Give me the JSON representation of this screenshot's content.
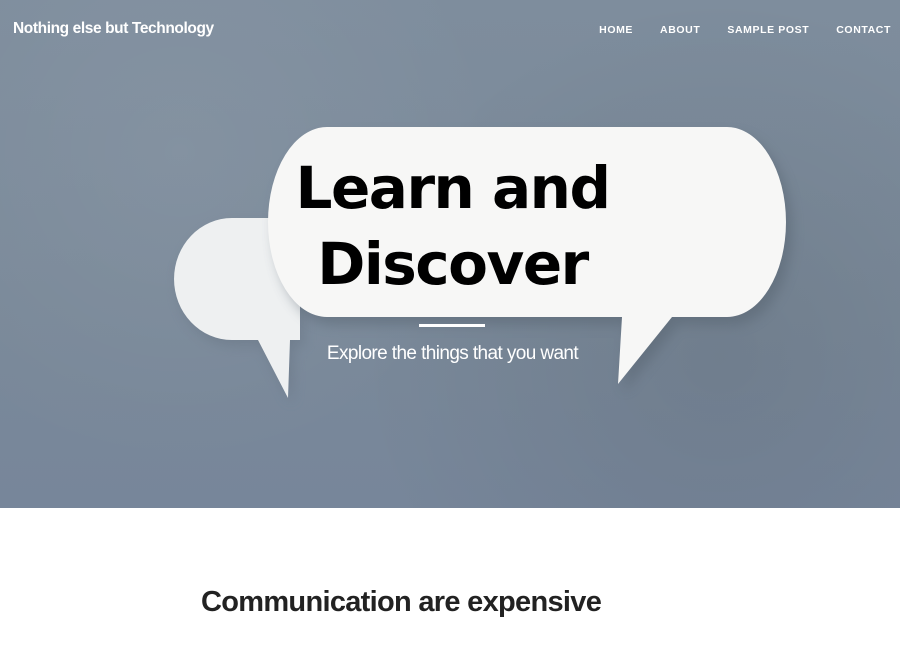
{
  "navbar": {
    "brand": "Nothing else but Technology",
    "items": [
      {
        "label": "HOME"
      },
      {
        "label": "ABOUT"
      },
      {
        "label": "SAMPLE POST"
      },
      {
        "label": "CONTACT"
      }
    ]
  },
  "hero": {
    "title_line1": "Learn and",
    "title_line2": "Discover",
    "subtitle": "Explore the things that you want"
  },
  "main": {
    "post_title": "Communication are expensive"
  },
  "colors": {
    "hero_background": "#7c8b9b",
    "bubble": "#f7f7f6",
    "title_text": "#000000",
    "heading_text": "#222222"
  }
}
